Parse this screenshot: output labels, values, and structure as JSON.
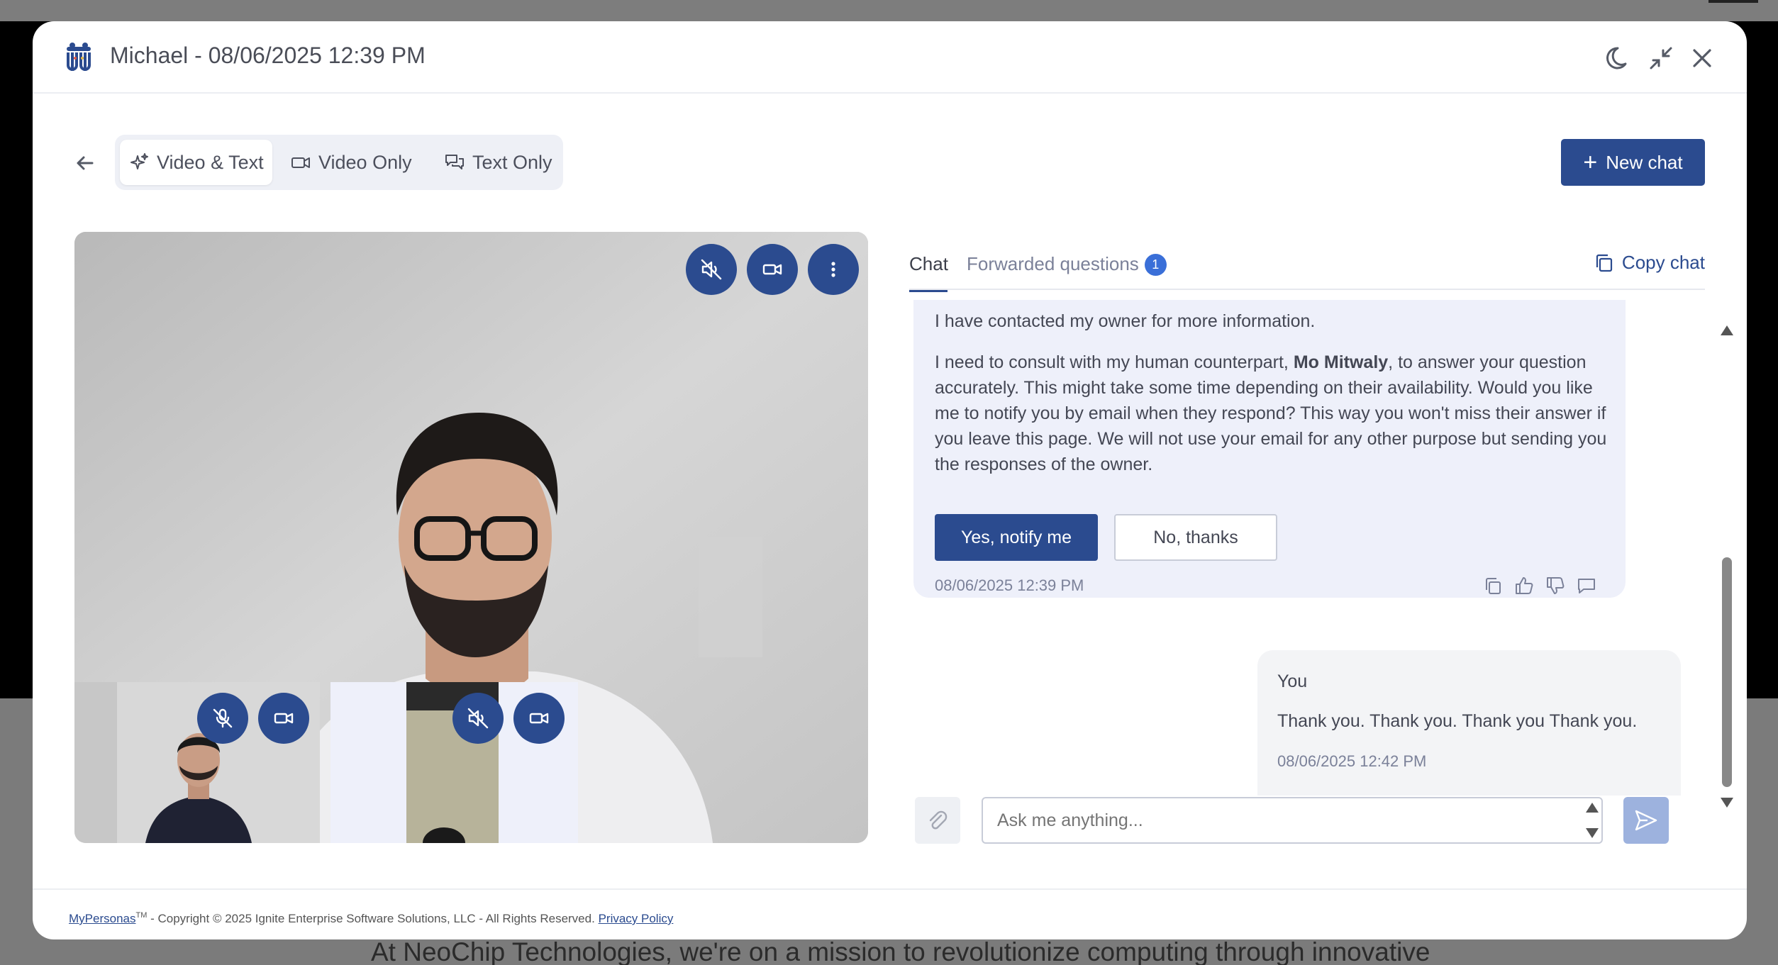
{
  "header": {
    "title": "Michael - 08/06/2025 12:39 PM",
    "icons": [
      "app-logo-icon",
      "moon-icon",
      "minimize-icon",
      "close-icon"
    ]
  },
  "toolbar": {
    "modes": [
      {
        "label": "Video & Text",
        "icon": "sparkle-icon",
        "active": true
      },
      {
        "label": "Video Only",
        "icon": "video-camera-icon",
        "active": false
      },
      {
        "label": "Text Only",
        "icon": "chat-bubbles-icon",
        "active": false
      }
    ],
    "new_chat_label": "New chat"
  },
  "chat": {
    "tabs": {
      "chat": "Chat",
      "forwarded": "Forwarded questions",
      "forwarded_count": "1"
    },
    "copy_chat_label": "Copy chat",
    "bot_message": {
      "line1": "I have contacted my owner for more information.",
      "para_before": "I need to consult with my human counterpart, ",
      "owner_name": "Mo Mitwaly",
      "para_after": ", to answer your question accurately. This might take some time depending on their availability. Would you like me to notify you by email when they respond? This way you won't miss their answer if you leave this page. We will not use your email for any other purpose but sending you the responses of the owner.",
      "yes_label": "Yes, notify me",
      "no_label": "No, thanks",
      "timestamp": "08/06/2025 12:39 PM"
    },
    "user_message": {
      "author": "You",
      "text": "Thank you. Thank you. Thank you Thank you.",
      "timestamp": "08/06/2025 12:42 PM"
    },
    "input_placeholder": "Ask me anything..."
  },
  "footer": {
    "brand": "MyPersonas",
    "tm": "TM",
    "copyright": " - Copyright © 2025 Ignite Enterprise Software Solutions, LLC - All Rights Reserved.",
    "privacy": "Privacy Policy"
  },
  "background": {
    "page_text": "At NeoChip Technologies, we're on a mission to revolutionize computing through innovative"
  },
  "colors": {
    "primary": "#2b4b8f",
    "badge": "#3a6fd8",
    "bot_bubble": "#eef0fa",
    "user_bubble": "#f3f4f6"
  }
}
